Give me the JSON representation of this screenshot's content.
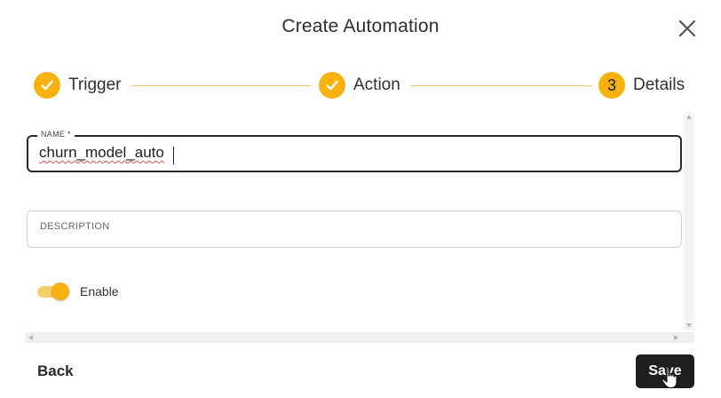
{
  "dialog": {
    "title": "Create Automation",
    "close_icon": "close-icon"
  },
  "stepper": {
    "steps": [
      {
        "label": "Trigger",
        "status": "completed",
        "icon": "check-icon"
      },
      {
        "label": "Action",
        "status": "completed",
        "icon": "check-icon"
      },
      {
        "label": "Details",
        "status": "active",
        "number": "3"
      }
    ],
    "accent_color": "#f7b20f"
  },
  "form": {
    "name": {
      "label": "NAME *",
      "value": "churn_model_auto"
    },
    "description": {
      "placeholder": "DESCRIPTION"
    },
    "enable": {
      "label": "Enable",
      "checked": true
    }
  },
  "footer": {
    "back_label": "Back",
    "save_label": "Save"
  }
}
